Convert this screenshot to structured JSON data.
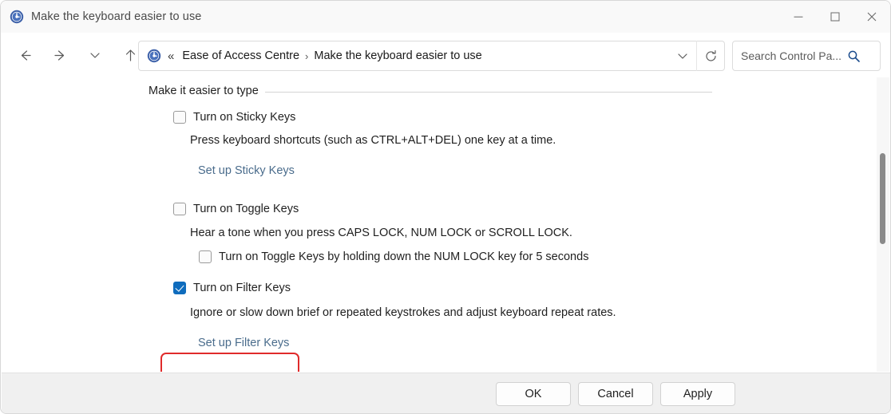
{
  "window": {
    "title": "Make the keyboard easier to use",
    "app_icon": "ease-of-access-icon",
    "controls": {
      "minimize": "minimize-icon",
      "maximize": "maximize-icon",
      "close": "close-icon"
    }
  },
  "nav": {
    "back": "back-arrow-icon",
    "forward": "forward-arrow-icon",
    "recent": "chevron-down-icon",
    "up": "up-arrow-icon",
    "address": {
      "icon": "ease-of-access-icon",
      "overflow": "«",
      "crumbs": [
        "Ease of Access Centre",
        "Make the keyboard easier to use"
      ],
      "separator": "›",
      "dropdown": "chevron-down-icon",
      "refresh": "refresh-icon"
    },
    "search": {
      "value": "",
      "placeholder": "Search Control Pa...",
      "icon": "search-icon"
    }
  },
  "content": {
    "section_title": "Make it easier to type",
    "sticky": {
      "checkbox_label": "Turn on Sticky Keys",
      "checked": false,
      "description": "Press keyboard shortcuts (such as CTRL+ALT+DEL) one key at a time.",
      "link": "Set up Sticky Keys"
    },
    "toggle": {
      "checkbox_label": "Turn on Toggle Keys",
      "checked": false,
      "description": "Hear a tone when you press CAPS LOCK, NUM LOCK or SCROLL LOCK.",
      "sub_checkbox_label": "Turn on Toggle Keys by holding down the NUM LOCK key for 5 seconds",
      "sub_checked": false
    },
    "filter": {
      "checkbox_label": "Turn on Filter Keys",
      "checked": true,
      "description": "Ignore or slow down brief or repeated keystrokes and adjust keyboard repeat rates.",
      "link": "Set up Filter Keys",
      "highlight_color": "#e02b2b"
    }
  },
  "footer": {
    "ok": "OK",
    "cancel": "Cancel",
    "apply": "Apply"
  },
  "colors": {
    "accent": "#0f6cbd",
    "link": "#4a6c8c",
    "highlight": "#e02b2b",
    "titlebar": "#f9f9f9",
    "footer": "#f0f0f0"
  }
}
